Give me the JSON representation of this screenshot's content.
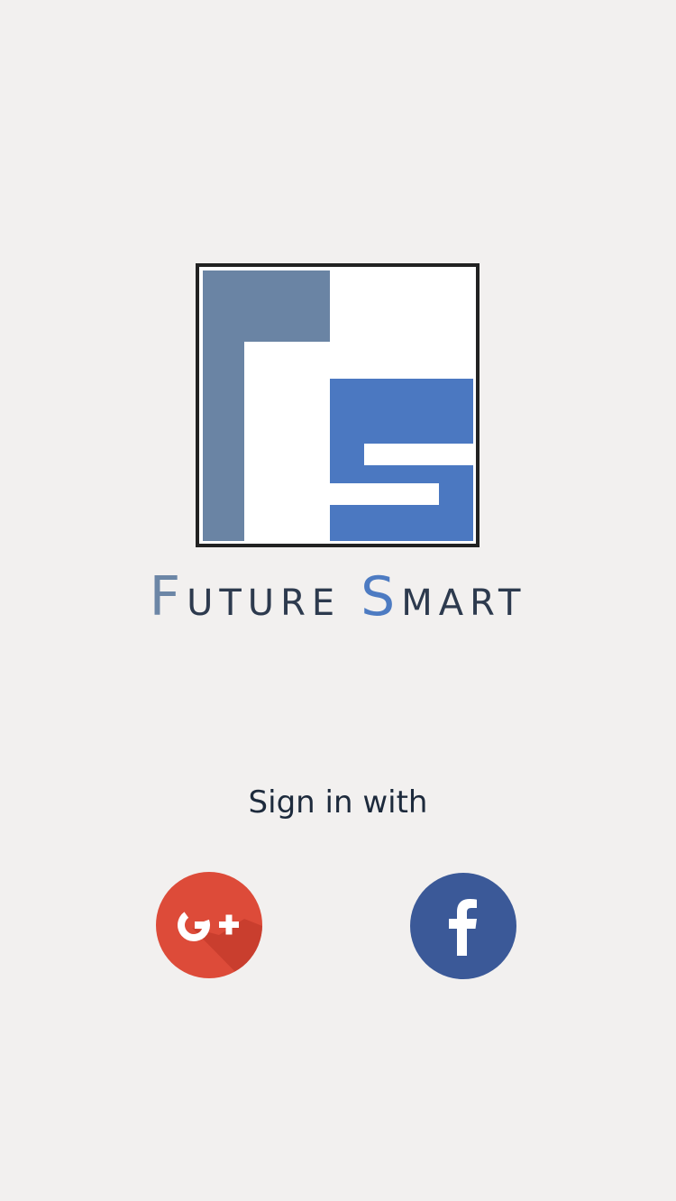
{
  "brand": {
    "logo_letters": "FS",
    "name_first_initial": "F",
    "name_first_rest": "UTURE",
    "name_second_initial": "S",
    "name_second_rest": "MART",
    "colors": {
      "f_letter": "#6a84a4",
      "s_letter": "#4b78c1",
      "text_dark": "#2d3a4e",
      "frame": "#222222"
    }
  },
  "signin": {
    "label": "Sign in with",
    "providers": [
      {
        "name": "Google+",
        "icon": "google-plus-icon",
        "color": "#dd4b39"
      },
      {
        "name": "Facebook",
        "icon": "facebook-icon",
        "color": "#3b5998"
      }
    ]
  }
}
